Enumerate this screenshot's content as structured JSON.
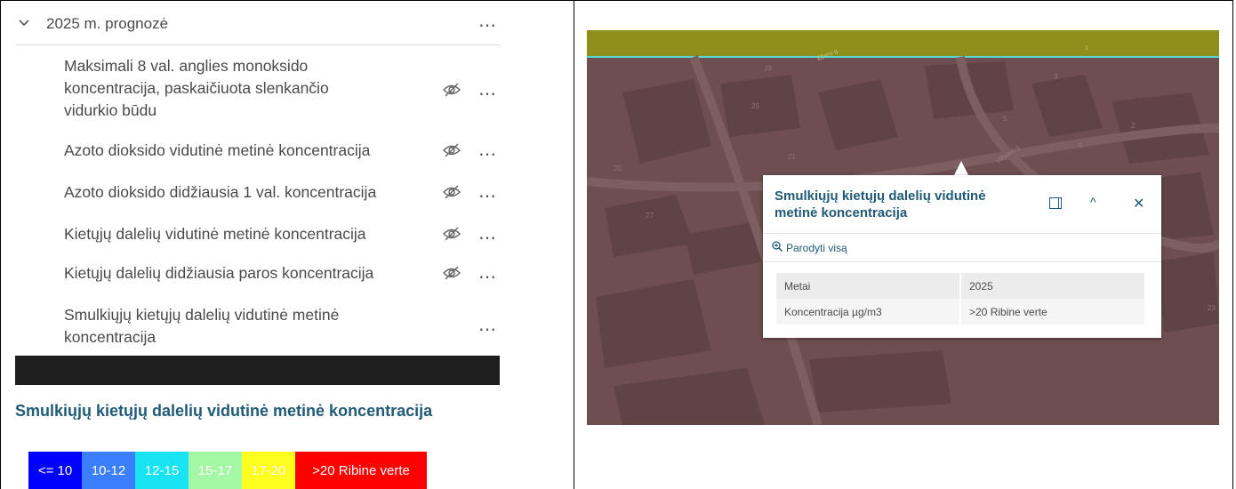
{
  "layer_panel": {
    "group": {
      "label": "2025 m. prognozė"
    },
    "layers": [
      {
        "lines": [
          "Maksimali 8 val. anglies monoksido",
          "koncentracija, paskaičiuota slenkančio",
          "vidurkio būdu"
        ],
        "hidden": true
      },
      {
        "lines": [
          "Azoto dioksido vidutinė metinė koncentracija"
        ],
        "hidden": true
      },
      {
        "lines": [
          "Azoto dioksido didžiausia 1 val. koncentracija"
        ],
        "hidden": true
      },
      {
        "lines": [
          "Kietųjų dalelių vidutinė metinė koncentracija"
        ],
        "hidden": true
      },
      {
        "lines": [
          "Kietųjų dalelių didžiausia paros koncentracija"
        ],
        "hidden": true
      },
      {
        "lines": [
          "Smulkiųjų kietųjų dalelių vidutinė metinė",
          "koncentracija"
        ],
        "hidden": false
      }
    ]
  },
  "legend": {
    "title": "Smulkiųjų kietųjų dalelių vidutinė metinė koncentracija",
    "classes": [
      {
        "label": "<= 10",
        "color": "#0000ff"
      },
      {
        "label": "10-12",
        "color": "#3b7fff"
      },
      {
        "label": "12-15",
        "color": "#19e3f3"
      },
      {
        "label": "15-17",
        "color": "#a4f7a4"
      },
      {
        "label": "17-20",
        "color": "#ffff1e"
      },
      {
        "label": ">20 Ribine verte",
        "color": "#ff0000"
      }
    ]
  },
  "popup": {
    "title": "Smulkiųjų kietųjų dalelių vidutinė metinė koncentracija",
    "zoom_label": "Parodyti visą",
    "rows": [
      {
        "key": "Metai",
        "value": "2025"
      },
      {
        "key": "Koncentracija µg/m3",
        "value": ">20 Ribine verte"
      }
    ]
  },
  "map": {
    "street_labels": [
      "Ežero g.",
      "Vilniaus g."
    ],
    "building_numbers": [
      "23",
      "25",
      "1",
      "3",
      "5",
      "21",
      "4",
      "20",
      "27",
      "2",
      "23"
    ]
  },
  "colors": {
    "map_fill": "#6e4e50",
    "top_band": "#8e8e1a",
    "title_accent": "#1f5a77"
  }
}
